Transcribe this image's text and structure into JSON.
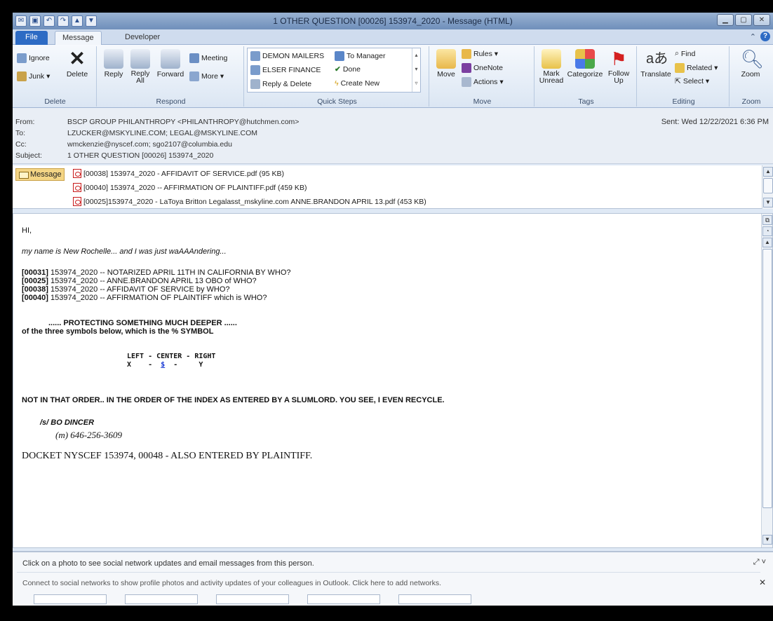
{
  "window": {
    "title": "1 OTHER QUESTION  [00026] 153974_2020  -  Message (HTML)"
  },
  "tabs": [
    {
      "label": "File"
    },
    {
      "label": "Message"
    },
    {
      "label": "Developer"
    }
  ],
  "ribbon": {
    "delete": {
      "ignore": "Ignore",
      "junk": "Junk",
      "delete": "Delete",
      "group": "Delete"
    },
    "respond": {
      "reply": "Reply",
      "reply_all": "Reply All",
      "forward": "Forward",
      "meeting": "Meeting",
      "more": "More",
      "group": "Respond"
    },
    "quick_steps": {
      "items": [
        "DEMON MAILERS",
        "ELSER FINANCE",
        "Reply & Delete",
        "To Manager",
        "Done",
        "Create New"
      ],
      "group": "Quick Steps"
    },
    "move": {
      "move": "Move",
      "rules": "Rules",
      "onenote": "OneNote",
      "actions": "Actions",
      "group": "Move"
    },
    "tags": {
      "mark_unread": "Mark Unread",
      "categorize": "Categorize",
      "follow_up": "Follow Up",
      "group": "Tags"
    },
    "editing": {
      "translate": "Translate",
      "find": "Find",
      "related": "Related",
      "select": "Select",
      "group": "Editing"
    },
    "zoom": {
      "zoom": "Zoom",
      "group": "Zoom"
    }
  },
  "headers": {
    "from_label": "From:",
    "from": "BSCP GROUP PHILANTHROPY <PHILANTHROPY@hutchmen.com>",
    "to_label": "To:",
    "to": "LZUCKER@MSKYLINE.COM; LEGAL@MSKYLINE.COM",
    "cc_label": "Cc:",
    "cc": "wmckenzie@nyscef.com; sgo2107@columbia.edu",
    "subject_label": "Subject:",
    "subject": "1 OTHER QUESTION  [00026] 153974_2020",
    "sent": "Sent:   Wed 12/22/2021 6:36 PM"
  },
  "attachments": {
    "message_tab": "Message",
    "files": [
      "[00038] 153974_2020 - AFFIDAVIT OF SERVICE.pdf (95 KB)",
      "[00040] 153974_2020 -- AFFIRMATION OF PLAINTIFF.pdf (459 KB)",
      "[00025]153974_2020 - LaToya Britton Legalasst_mskyline.com ANNE.BRANDON APRIL 13.pdf (453 KB)"
    ]
  },
  "body": {
    "greeting": "HI,",
    "intro": "my name is New Rochelle... and I was just waAAAndering...",
    "lines": [
      {
        "ref": "[00031]",
        "text": " 153974_2020  -- NOTARIZED APRIL 11TH IN CALIFORNIA BY WHO?"
      },
      {
        "ref": "[00025]",
        "text": " 153974_2020  -- ANNE.BRANDON APRIL 13 OBO of WHO?"
      },
      {
        "ref": "[00038]",
        "text": " 153974_2020  -- AFFIDAVIT OF SERVICE by WHO?"
      },
      {
        "ref": "[00040]",
        "text": " 153974_2020  -- AFFIRMATION OF PLAINTIFF which is WHO?"
      }
    ],
    "protect": "......  PROTECTING SOMETHING MUCH DEEPER  ......",
    "symbols_q": "of the three symbols below, which is the % SYMBOL",
    "sym_header": "LEFT - CENTER - RIGHT",
    "sym_x": "X    -  ",
    "sym_s": "$",
    "sym_y": "  -     Y",
    "order": "NOT IN THAT ORDER.. IN THE ORDER OF THE INDEX AS ENTERED BY A SLUMLORD. YOU SEE, I EVEN RECYCLE.",
    "sig": "/s/ BO DINCER",
    "phone": "(m) 646-256-3609",
    "docket": "DOCKET NYSCEF 153974, 00048 - ALSO ENTERED BY PLAINTIFF."
  },
  "social": {
    "line1": "Click on a photo to see social network updates and email messages from this person.",
    "line2": "Connect to social networks to show profile photos and activity updates of your colleagues in Outlook. Click here to add networks."
  }
}
